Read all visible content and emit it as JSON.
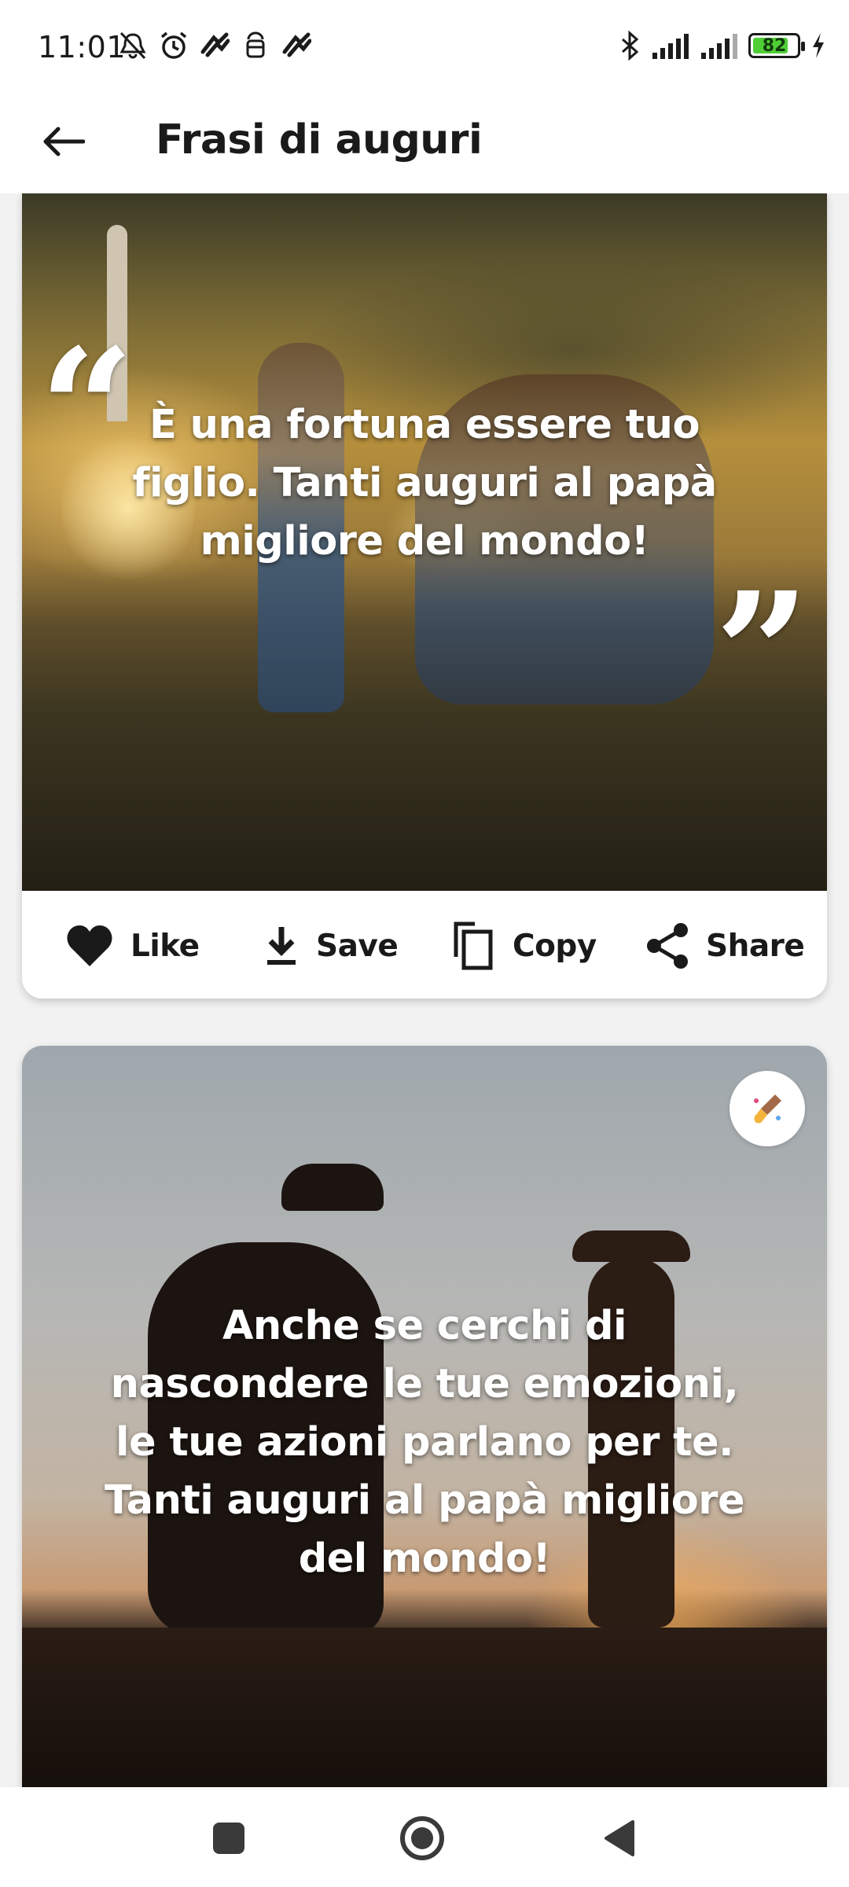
{
  "status_bar": {
    "time": "11:01",
    "battery_level": "82",
    "battery_fraction": 0.82,
    "battery_color": "#4fcf35",
    "left_icons": [
      "mute-icon",
      "alarm-icon",
      "app-notification-icon",
      "android-icon",
      "app-notification-icon"
    ],
    "right_icons": [
      "bluetooth-icon",
      "signal-icon",
      "signal-icon",
      "battery-icon",
      "charging-icon"
    ]
  },
  "app_bar": {
    "title": "Frasi di auguri",
    "back_icon": "arrow-left-icon"
  },
  "cards": [
    {
      "quote": "È una fortuna essere tuo figlio. Tanti auguri al papà migliore del mondo!",
      "quote_lines": [
        "È una fortuna essere tuo",
        "figlio. Tanti auguri al papà",
        "migliore del mondo!"
      ],
      "open_quote": "“",
      "close_quote": "”",
      "actions": [
        {
          "label": "Like",
          "icon": "heart-icon"
        },
        {
          "label": "Save",
          "icon": "download-icon"
        },
        {
          "label": "Copy",
          "icon": "copy-icon"
        },
        {
          "label": "Share",
          "icon": "share-icon"
        }
      ]
    },
    {
      "quote": "Anche se cerchi di nascondere le tue emozioni, le tue azioni parlano per te. Tanti auguri al papà migliore del mondo!",
      "quote_lines": [
        "Anche se cerchi di",
        "nascondere le tue emozioni,",
        "le tue azioni parlano per te.",
        "Tanti auguri al papà migliore",
        "del mondo!"
      ],
      "edit_icon": "brush-icon"
    }
  ],
  "nav_bar": {
    "buttons": [
      "recents-square-icon",
      "home-circle-icon",
      "back-triangle-icon"
    ]
  }
}
